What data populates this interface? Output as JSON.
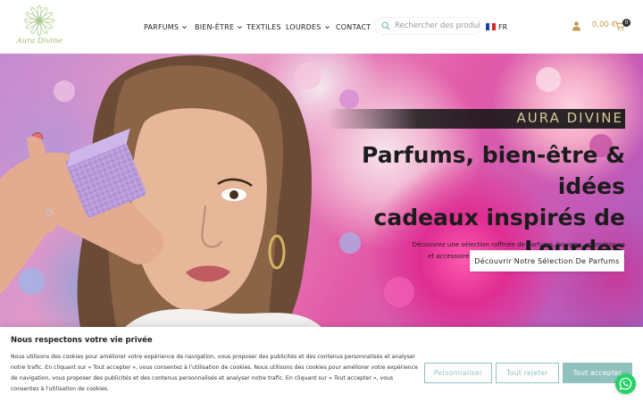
{
  "header": {
    "logo_text": "Aura Divine",
    "nav": [
      {
        "label": "PARFUMS",
        "has_dropdown": true
      },
      {
        "label": "BIEN-ÊTRE",
        "has_dropdown": true
      },
      {
        "label": "TEXTILES",
        "has_dropdown": false
      },
      {
        "label": "LOURDES",
        "has_dropdown": true
      },
      {
        "label": "CONTACT",
        "has_dropdown": false
      }
    ],
    "search": {
      "placeholder": "Rechercher des produits"
    },
    "language": "FR",
    "cart": {
      "total": "0,00 €",
      "count": "0"
    }
  },
  "hero": {
    "kicker": "AURA DIVINE",
    "title": "Parfums, bien-être & idées cadeaux inspirés de Lourdes",
    "title_lines": [
      "Parfums, bien-être & idées",
      "cadeaux inspirés de",
      "Lourdes"
    ],
    "text_lines": [
      "Découvrez une sélection raffinée de parfums, bougies, cosmétiques",
      "et accessoires, choisis avec soin dans notre boutique située au",
      "cœur de Lourdes."
    ],
    "cta": "Découvrir Notre Sélection De Parfums"
  },
  "cookie": {
    "title": "Nous respectons votre vie privée",
    "text": "Nous utilisons des cookies pour améliorer votre expérience de navigation, vous proposer des publicités et des contenus personnalisés et analyser notre trafic. En cliquant sur « Tout accepter », vous consentez à l'utilisation de cookies. Nous utilisons des cookies pour améliorer votre expérience de navigation, vous proposer des publicités et des contenus personnalisés et analyser notre trafic. En cliquant sur « Tout accepter », vous consentez à l'utilisation de cookies.",
    "buttons": {
      "customize": "Personnaliser",
      "reject": "Tout rejeter",
      "accept": "Tout accepter"
    }
  },
  "colors": {
    "accent_gold": "#c89a5a",
    "logo_green": "#9fbf6a",
    "cookie_teal": "#8fc1bd",
    "whatsapp_green": "#25d366"
  },
  "icons": [
    "logo-flower-icon",
    "chevron-down-icon",
    "search-icon",
    "french-flag-icon",
    "user-icon",
    "cart-icon",
    "whatsapp-icon"
  ]
}
